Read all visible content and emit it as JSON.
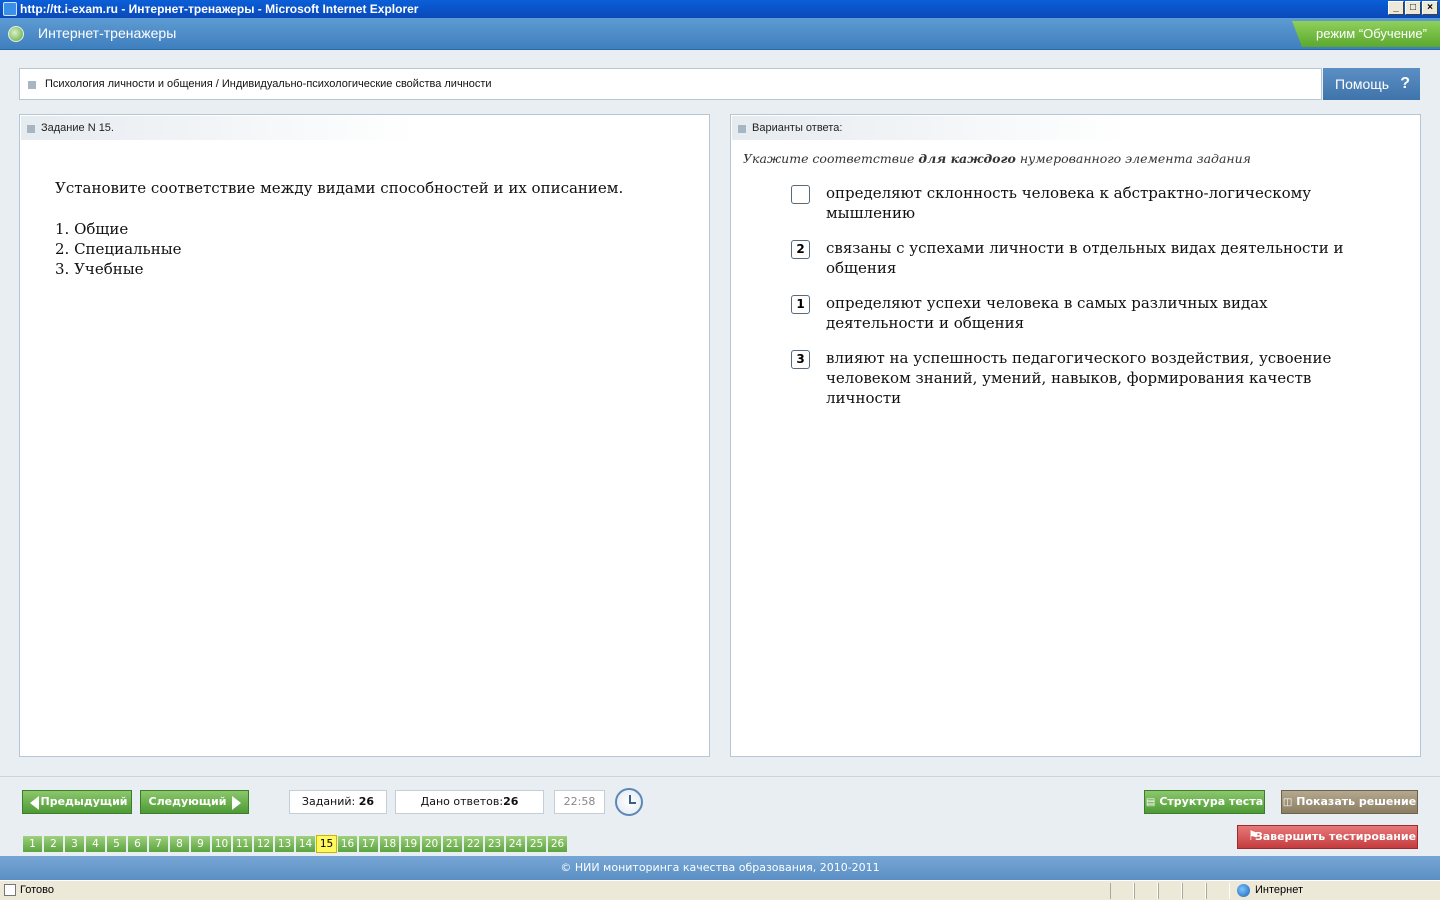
{
  "window": {
    "title": "http://tt.i-exam.ru - Интернет-тренажеры - Microsoft Internet Explorer",
    "min": "_",
    "max": "□",
    "close": "×"
  },
  "header": {
    "app_title": "Интернет-тренажеры",
    "mode": "режим “Обучение”"
  },
  "breadcrumb": "Психология личности и общения / Индивидуально-психологические свойства личности",
  "help": {
    "label": "Помощь",
    "icon": "?"
  },
  "task": {
    "header": "Задание N 15.",
    "question": "Установите соответствие между видами способностей и их описанием.",
    "items": [
      "1. Общие",
      "2. Специальные",
      "3. Учебные"
    ]
  },
  "answers": {
    "header": "Варианты ответа:",
    "instruction_pre": "Укажите соответствие ",
    "instruction_bold": "для каждого",
    "instruction_post": " нумерованного элемента задания",
    "options": [
      {
        "value": "",
        "text": "определяют склонность человека к абстрактно-логическому мышлению"
      },
      {
        "value": "2",
        "text": "связаны с успехами личности в отдельных видах деятельности и общения"
      },
      {
        "value": "1",
        "text": "определяют успехи человека в самых различных видах деятельности и общения"
      },
      {
        "value": "3",
        "text": "влияют на успешность педагогического воздействия, усвоение человеком знаний, умений, навыков, формирования качеств личности"
      }
    ]
  },
  "toolbar": {
    "prev": "Предыдущий",
    "next": "Следующий",
    "tasks_label": "Заданий:",
    "tasks_count": "26",
    "answered_label": "Дано ответов:",
    "answered_count": "26",
    "timer": "22:58",
    "structure": "Структура теста",
    "show_solution": "Показать решение",
    "finish": "Завершить тестирование"
  },
  "pages": [
    "1",
    "2",
    "3",
    "4",
    "5",
    "6",
    "7",
    "8",
    "9",
    "10",
    "11",
    "12",
    "13",
    "14",
    "15",
    "16",
    "17",
    "18",
    "19",
    "20",
    "21",
    "22",
    "23",
    "24",
    "25",
    "26"
  ],
  "current_page": "15",
  "footer": "© НИИ мониторинга качества образования, 2010-2011",
  "status": {
    "text": "Готово",
    "zone": "Интернет"
  }
}
